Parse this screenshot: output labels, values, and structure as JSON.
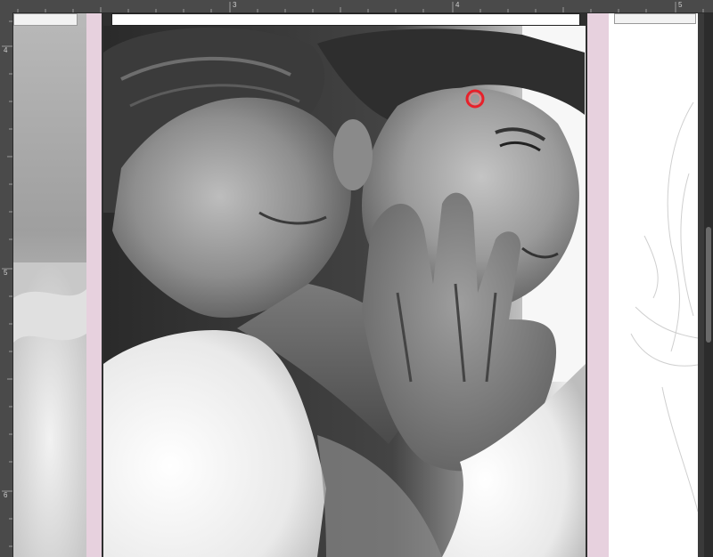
{
  "ruler": {
    "top_labels": [
      "3",
      "4",
      "5"
    ],
    "left_labels": [
      "4",
      "5",
      "6"
    ]
  },
  "canvas": {
    "artwork_description_icon": "painting-canvas",
    "cursor_icon": "brush-cursor-icon"
  },
  "colors": {
    "bleed_strip": "#e7d1de",
    "cursor_ring": "#e8202a",
    "background": "#3a3a3a"
  }
}
